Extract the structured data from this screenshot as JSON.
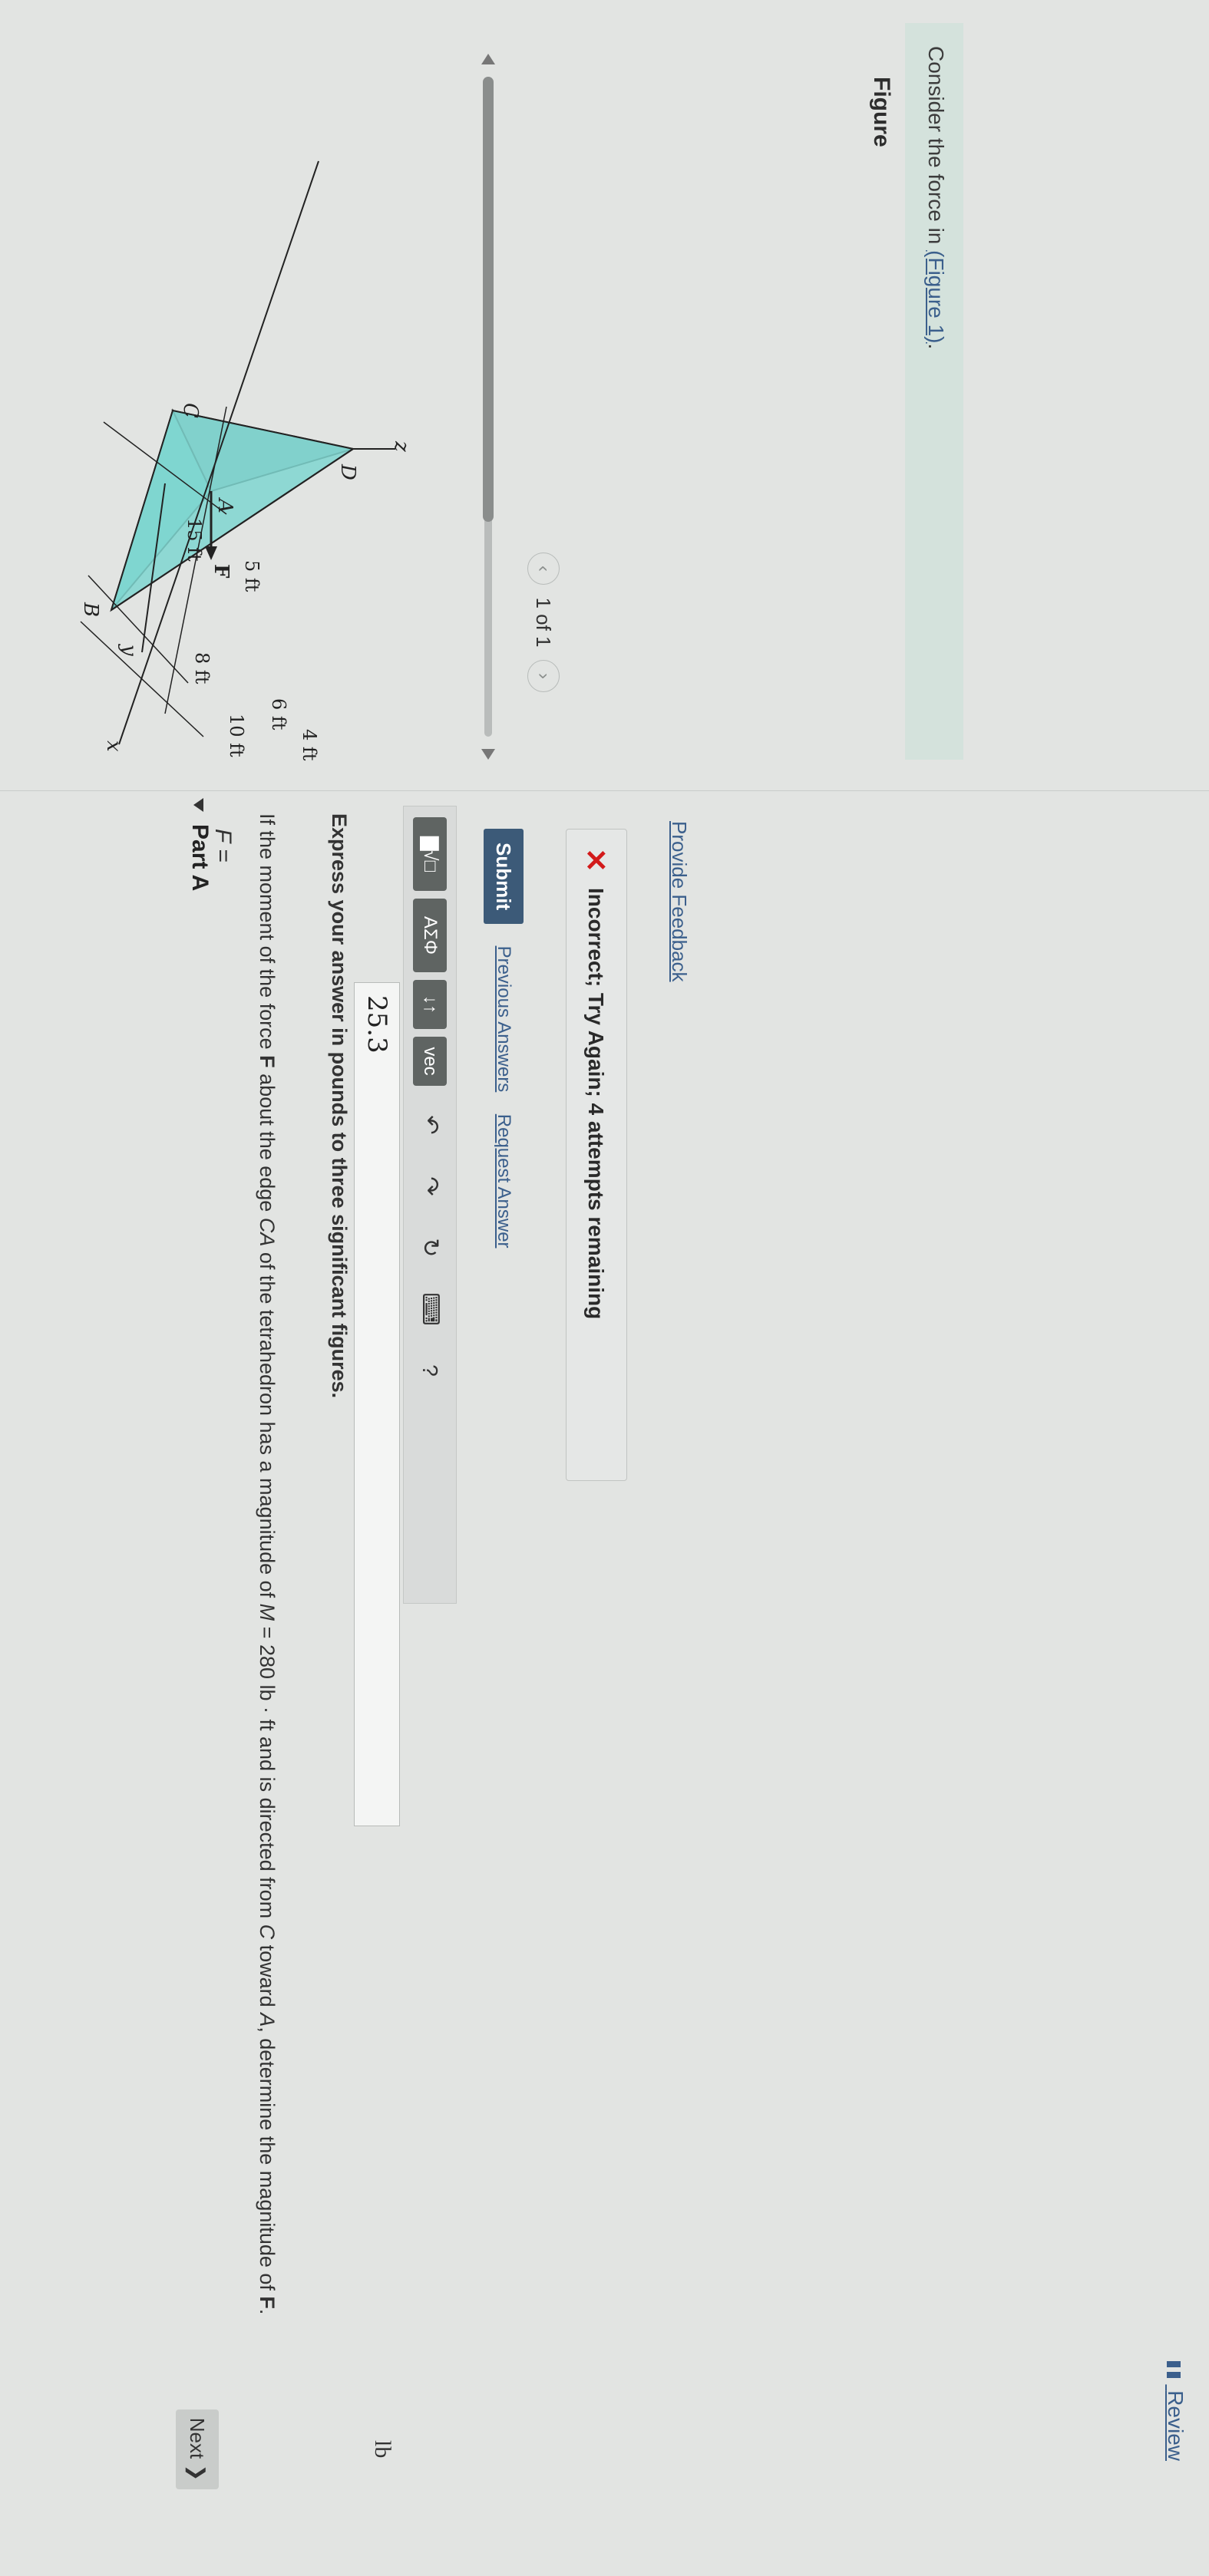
{
  "header": {
    "review_label": "Review"
  },
  "left": {
    "consider_prefix": "Consider the force in ",
    "consider_link": "(Figure 1)",
    "consider_suffix": ".",
    "figure_label": "Figure",
    "pager": {
      "text": "1 of 1",
      "prev_icon": "chevron-left-icon",
      "next_icon": "chevron-right-icon"
    },
    "figure": {
      "labels": {
        "x": "x",
        "y": "y",
        "z": "z",
        "A": "A",
        "B": "B",
        "C": "C",
        "D": "D",
        "F": "F",
        "d8": "8 ft",
        "d5": "5 ft",
        "d15": "15 ft",
        "d10": "10 ft",
        "d6": "6 ft",
        "d4": "4 ft"
      },
      "colors": {
        "face": "#7fd6d0",
        "face_dark": "#8fb6b2",
        "edge": "#222222"
      }
    }
  },
  "part": {
    "title": "Part A",
    "question_pre": "If the moment of the force ",
    "question_F": "F",
    "question_mid1": " about the edge ",
    "question_CA": "CA",
    "question_mid2": " of the tetrahedron has a magnitude of ",
    "question_M": "M",
    "question_val": " = 280 lb · ft",
    "question_mid3": " and is directed from ",
    "question_C": "C",
    "question_mid4": " toward ",
    "question_A": "A",
    "question_end": ", determine the magnitude of ",
    "question_F2": "F",
    "question_dot": ".",
    "express": "Express your answer in pounds to three significant figures.",
    "toolbar": {
      "template_label": "▇√□",
      "greek_label": "ΑΣΦ",
      "arrows_label": "↓↑",
      "vec_label": "vec",
      "help_label": "?"
    },
    "answer_label": "F =",
    "answer_value": "25.3",
    "unit": "lb",
    "submit_label": "Submit",
    "previous_answers": "Previous Answers",
    "request_answer": "Request Answer",
    "feedback_icon": "✕",
    "feedback_text": "Incorrect; Try Again; 4 attempts remaining",
    "provide_feedback": "Provide Feedback"
  },
  "footer": {
    "next_label": "Next ❯"
  }
}
